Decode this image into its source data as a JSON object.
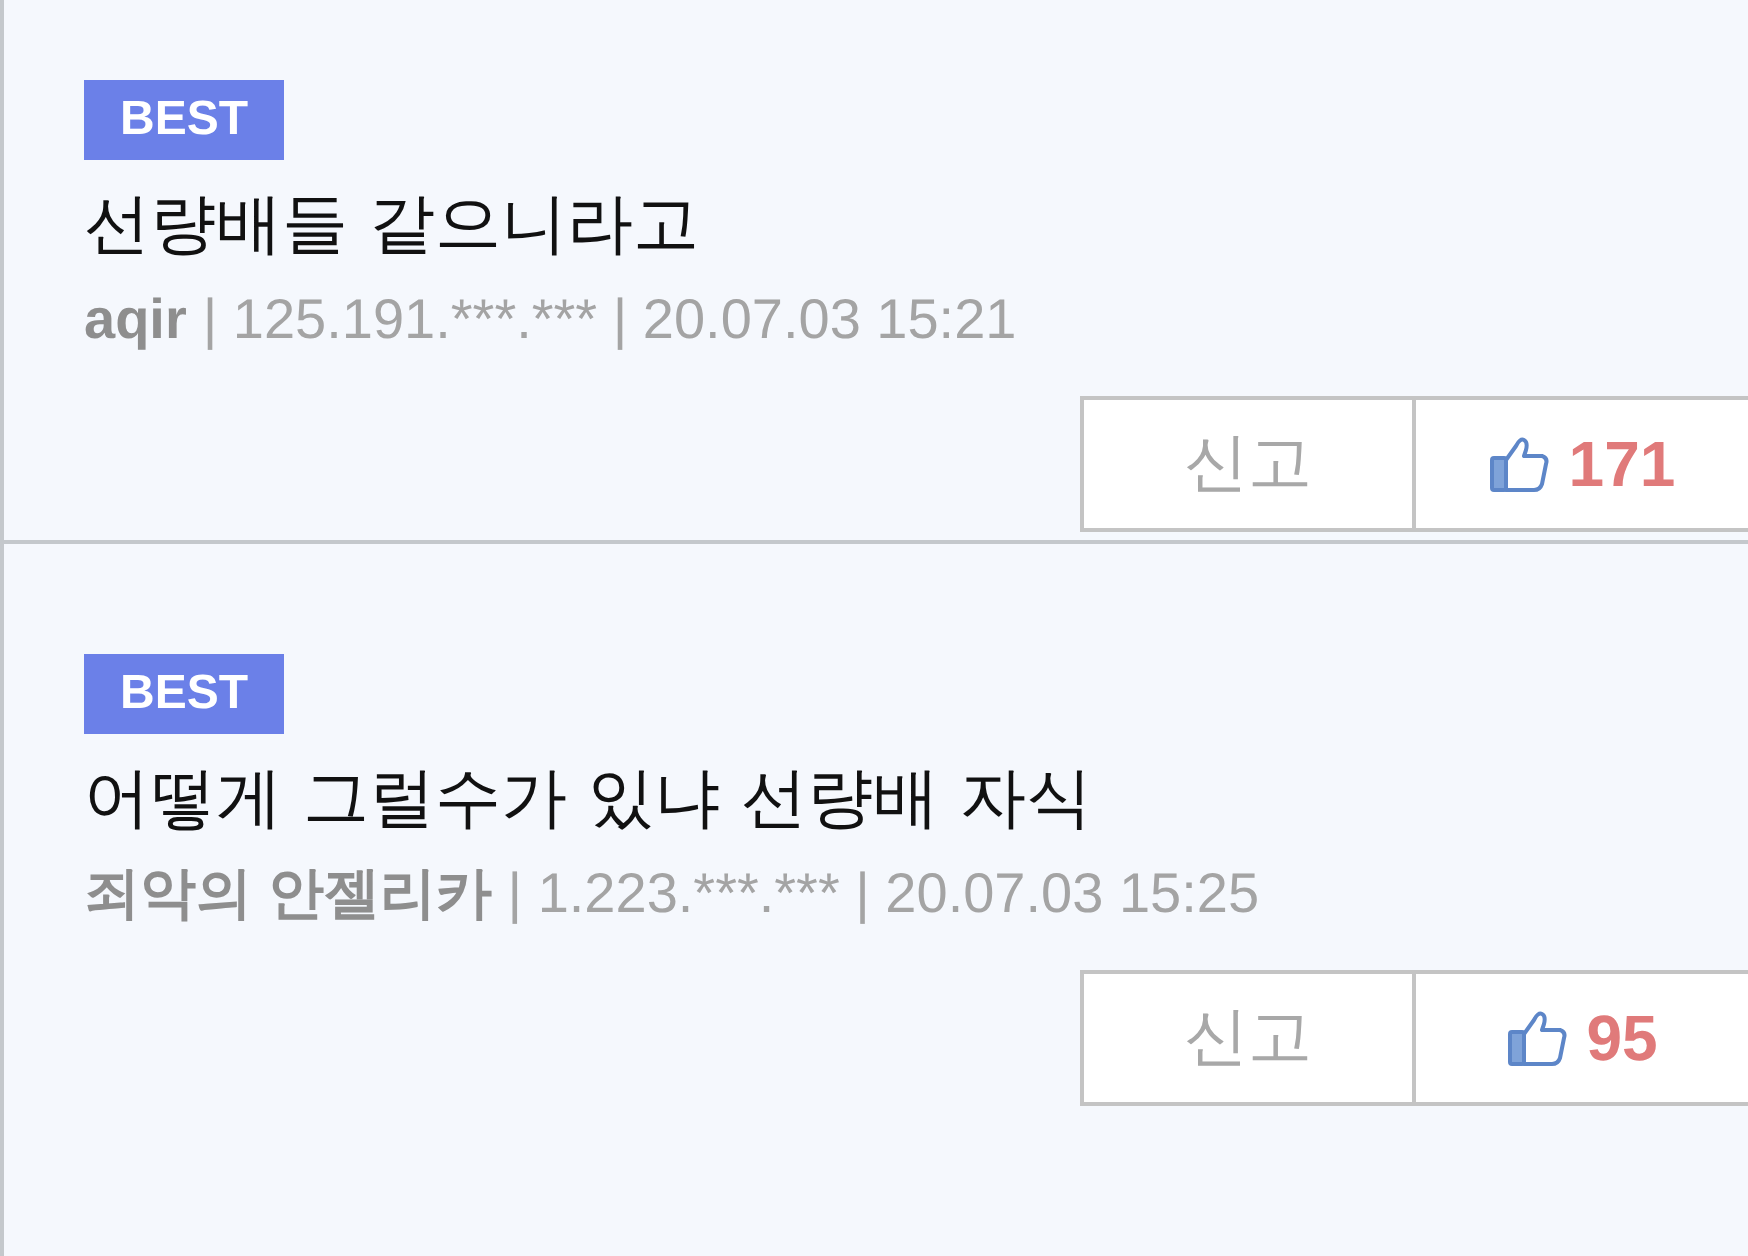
{
  "comments": [
    {
      "badge": "BEST",
      "text": "선량배들 같으니라고",
      "author": "aqir",
      "details": "| 125.191.***.*** | 20.07.03 15:21",
      "report_label": "신고",
      "likes": "171"
    },
    {
      "badge": "BEST",
      "text": "어떻게 그럴수가 있냐 선량배 자식",
      "author": "죄악의 안젤리카",
      "details": "| 1.223.***.*** | 20.07.03 15:25",
      "report_label": "신고",
      "likes": "95"
    }
  ]
}
